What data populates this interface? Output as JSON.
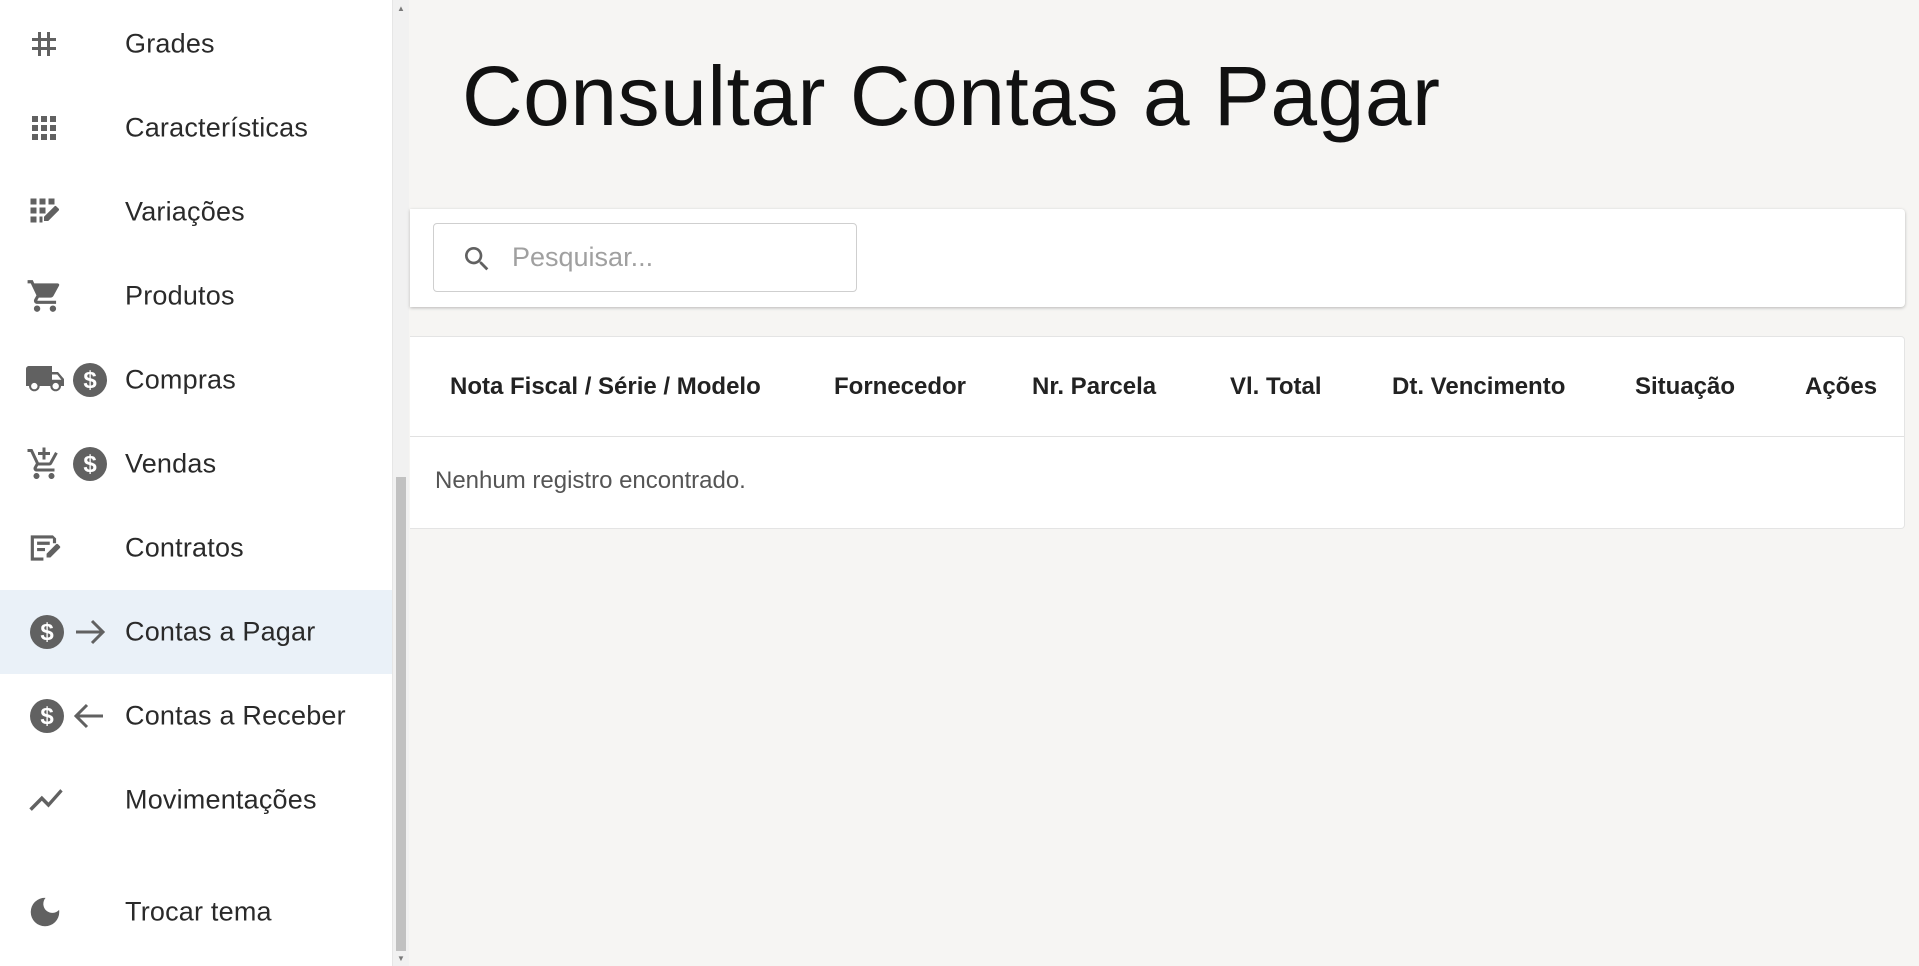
{
  "sidebar": {
    "items": [
      {
        "label": "Grades",
        "icon": "hash-icon",
        "active": false
      },
      {
        "label": "Características",
        "icon": "grid-icon",
        "active": false
      },
      {
        "label": "Variações",
        "icon": "grid-edit-icon",
        "active": false
      },
      {
        "label": "Produtos",
        "icon": "cart-icon",
        "active": false
      },
      {
        "label": "Compras",
        "icon": "truck-dollar-icon",
        "active": false
      },
      {
        "label": "Vendas",
        "icon": "cart-plus-dollar-icon",
        "active": false
      },
      {
        "label": "Contratos",
        "icon": "contract-icon",
        "active": false
      },
      {
        "label": "Contas a Pagar",
        "icon": "dollar-arrow-right-icon",
        "active": true
      },
      {
        "label": "Contas a Receber",
        "icon": "dollar-arrow-left-icon",
        "active": false
      },
      {
        "label": "Movimentações",
        "icon": "trend-icon",
        "active": false
      }
    ],
    "theme_toggle": {
      "label": "Trocar tema",
      "icon": "moon-icon"
    }
  },
  "page": {
    "title": "Consultar Contas a Pagar"
  },
  "search": {
    "placeholder": "Pesquisar...",
    "value": ""
  },
  "table": {
    "columns": [
      "Nota Fiscal / Série / Modelo",
      "Fornecedor",
      "Nr. Parcela",
      "Vl. Total",
      "Dt. Vencimento",
      "Situação",
      "Ações"
    ],
    "empty_message": "Nenhum registro encontrado."
  },
  "colors": {
    "active_item_bg": "#eaf1f8",
    "icon": "#616161",
    "page_bg": "#f6f5f3"
  }
}
